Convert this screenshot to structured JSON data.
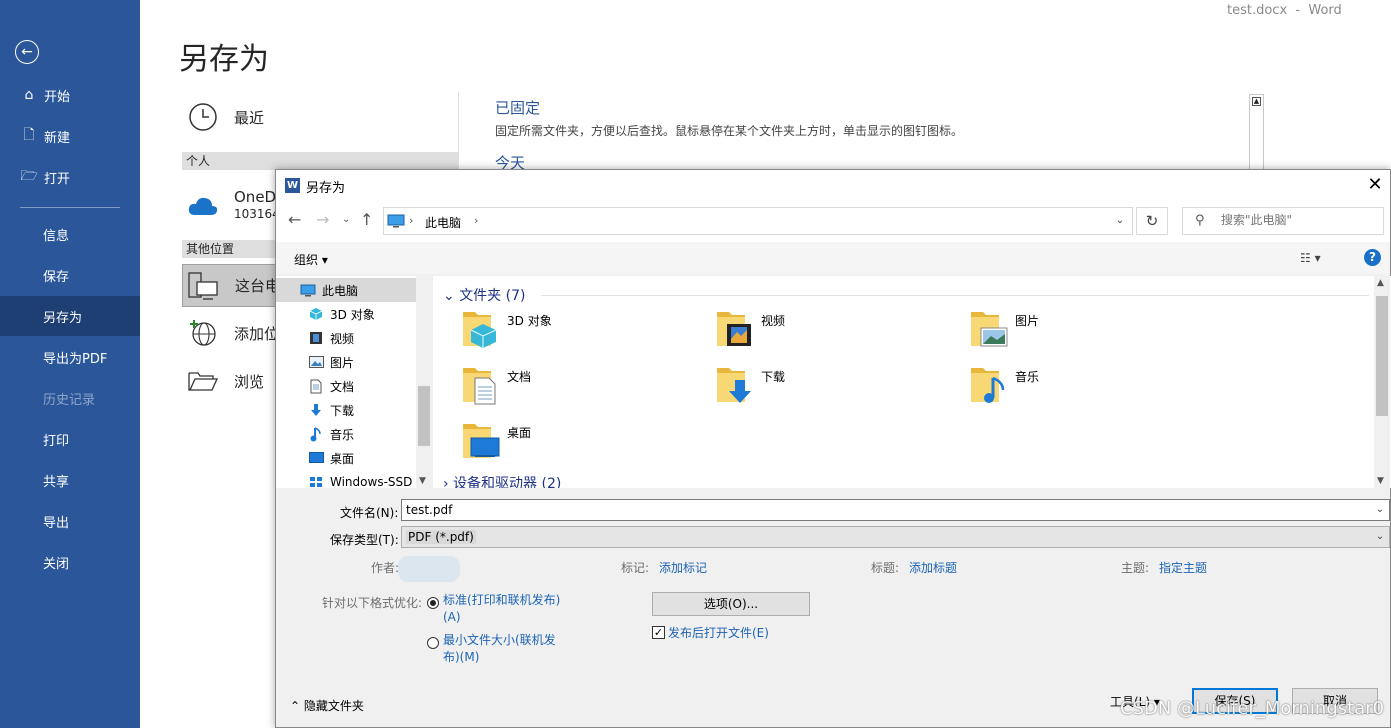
{
  "app_title": "test.docx  -  Word",
  "backstage": {
    "page_title": "另存为",
    "nav": {
      "home": "开始",
      "new": "新建",
      "open": "打开",
      "info": "信息",
      "save": "保存",
      "save_as": "另存为",
      "export_pdf": "导出为PDF",
      "history": "历史记录",
      "print": "打印",
      "share": "共享",
      "export": "导出",
      "close": "关闭"
    },
    "locations": {
      "recent": "最近",
      "personal_header": "个人",
      "onedrive": "OneD",
      "onedrive_sub": "103164",
      "other_header": "其他位置",
      "this_pc": "这台电",
      "add_place": "添加位",
      "browse": "浏览"
    },
    "pinned_title": "已固定",
    "pinned_desc": "固定所需文件夹，方便以后查找。鼠标悬停在某个文件夹上方时，单击显示的图钉图标。",
    "today_title": "今天"
  },
  "dialog": {
    "title": "另存为",
    "breadcrumb": "此电脑",
    "search_placeholder": "搜索\"此电脑\"",
    "organize": "组织 ▾",
    "nav_tree": [
      "此电脑",
      "3D 对象",
      "视频",
      "图片",
      "文档",
      "下载",
      "音乐",
      "桌面",
      "Windows-SSD"
    ],
    "group_header": "文件夹 (7)",
    "group2_header": "设备和驱动器 (2)",
    "folders": [
      "3D 对象",
      "视频",
      "图片",
      "文档",
      "下载",
      "音乐",
      "桌面"
    ],
    "filename_label": "文件名(N):",
    "filename_value": "test.pdf",
    "savetype_label": "保存类型(T):",
    "savetype_value": "PDF (*.pdf)",
    "author_label": "作者:",
    "tags_label": "标记:",
    "tags_link": "添加标记",
    "title_label": "标题:",
    "title_link": "添加标题",
    "subject_label": "主题:",
    "subject_link": "指定主题",
    "optimize_label": "针对以下格式优化:",
    "opt_standard": "标准(打印和联机发布)(A)",
    "opt_minimum": "最小文件大小(联机发布)(M)",
    "options_button": "选项(O)...",
    "open_after": "发布后打开文件(E)",
    "hide_folders": "隐藏文件夹",
    "tools": "工具(L)  ▾",
    "save": "保存(S)",
    "cancel": "取消"
  },
  "watermark": "CSDN @Lucifer_Morningstar0",
  "colors": {
    "word_blue": "#2b579a",
    "nav_active": "#1e3f73",
    "link_blue": "#1d64b4"
  },
  "icons": [
    "back-arrow-icon",
    "home-icon",
    "new-doc-icon",
    "open-folder-icon",
    "clock-icon",
    "cloud-icon",
    "computer-icon",
    "globe-icon",
    "folder-icon",
    "search-icon",
    "refresh-icon",
    "help-icon"
  ]
}
